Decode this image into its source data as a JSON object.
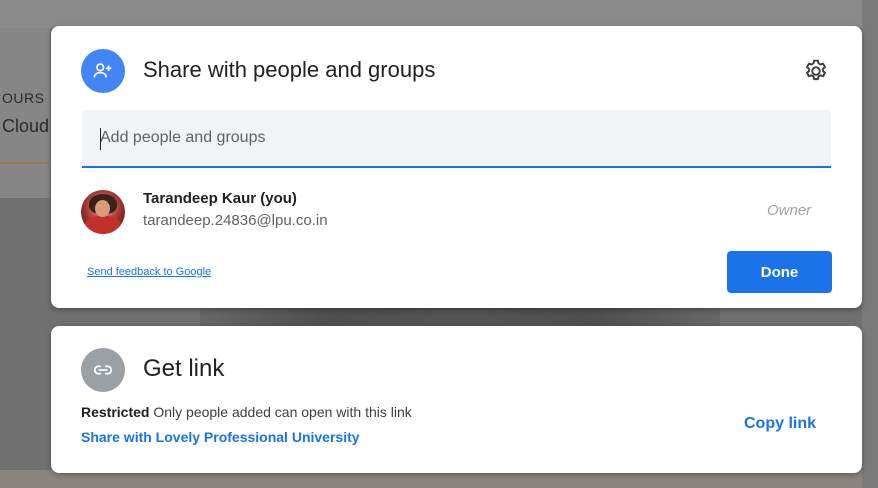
{
  "background": {
    "text_line_1": "OURS",
    "text_line_2": "Cloud"
  },
  "share_dialog": {
    "title": "Share with people and groups",
    "header_icon": "person-add-icon",
    "settings_icon": "gear-icon",
    "add_input": {
      "placeholder": "Add people and groups",
      "value": ""
    },
    "people": [
      {
        "name": "Tarandeep Kaur (you)",
        "email": "tarandeep.24836@lpu.co.in",
        "role": "Owner"
      }
    ],
    "feedback_link": "Send feedback to Google",
    "done_label": "Done"
  },
  "link_card": {
    "icon": "link-icon",
    "title": "Get link",
    "access_level": "Restricted",
    "access_description": "Only people added can open with this link",
    "share_org_link": "Share with Lovely Professional University",
    "copy_link_label": "Copy link"
  },
  "colors": {
    "accent": "#1a73e8",
    "header_icon_bg": "#4285f4",
    "link_icon_bg": "#9aa0a6"
  }
}
